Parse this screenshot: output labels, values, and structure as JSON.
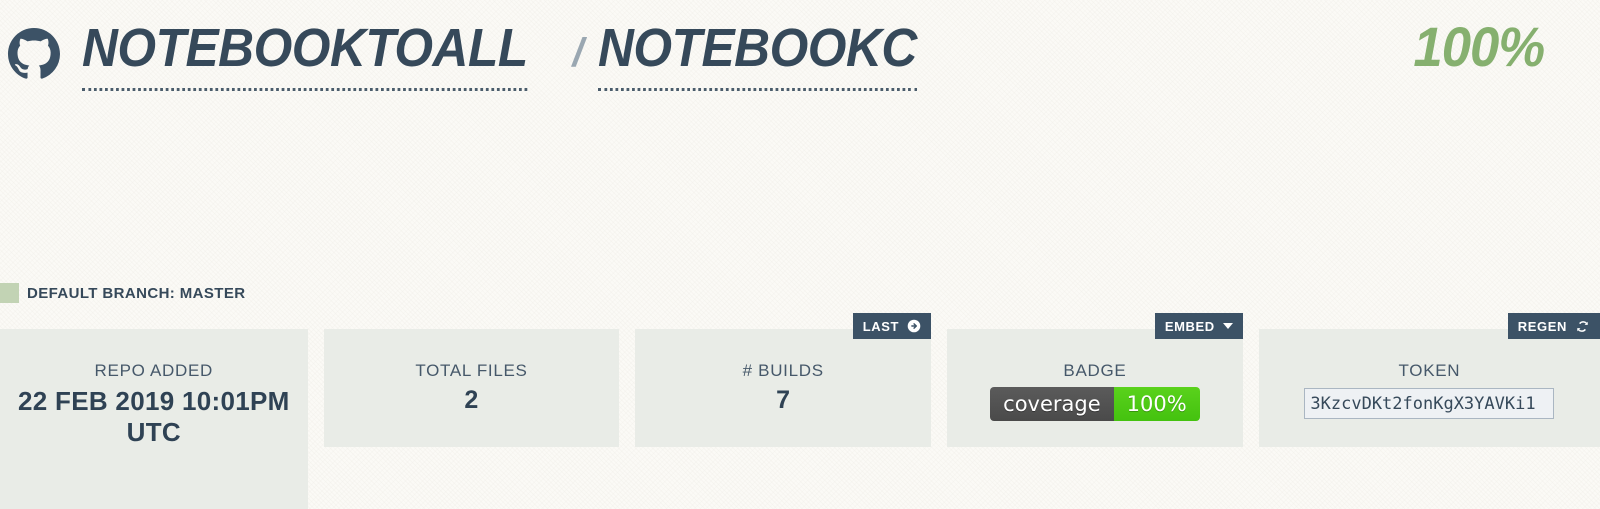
{
  "header": {
    "logo_icon": "github-icon",
    "owner": "NotebookToAll",
    "separator": "/",
    "repo": "notebookc",
    "coverage_percent": "100%"
  },
  "branch": {
    "label": "DEFAULT BRANCH: MASTER",
    "swatch_color": "#c2d3b4"
  },
  "cards": [
    {
      "label": "REPO ADDED",
      "value": "22 FEB 2019 10:01PM UTC"
    },
    {
      "label": "TOTAL FILES",
      "value": "2"
    },
    {
      "label": "# BUILDS",
      "value": "7",
      "action": {
        "label": "LAST",
        "icon": "arrow-circle-right-icon"
      }
    },
    {
      "label": "BADGE",
      "action": {
        "label": "EMBED",
        "icon": "chevron-down-icon"
      },
      "badge": {
        "left_text": "coverage",
        "right_text": "100%",
        "left_color": "#555555",
        "right_color": "#4c1"
      }
    },
    {
      "label": "TOKEN",
      "token_value": "3KzcvDKt2fonKgX3YAVKi1",
      "action": {
        "label": "REGEN",
        "icon": "refresh-icon"
      }
    }
  ],
  "colors": {
    "page_background": "#fbfaf6",
    "card_background": "#e9ece7",
    "text_dark": "#36495a",
    "accent_green": "#86b06f",
    "badge_dark": "#3c5266"
  }
}
